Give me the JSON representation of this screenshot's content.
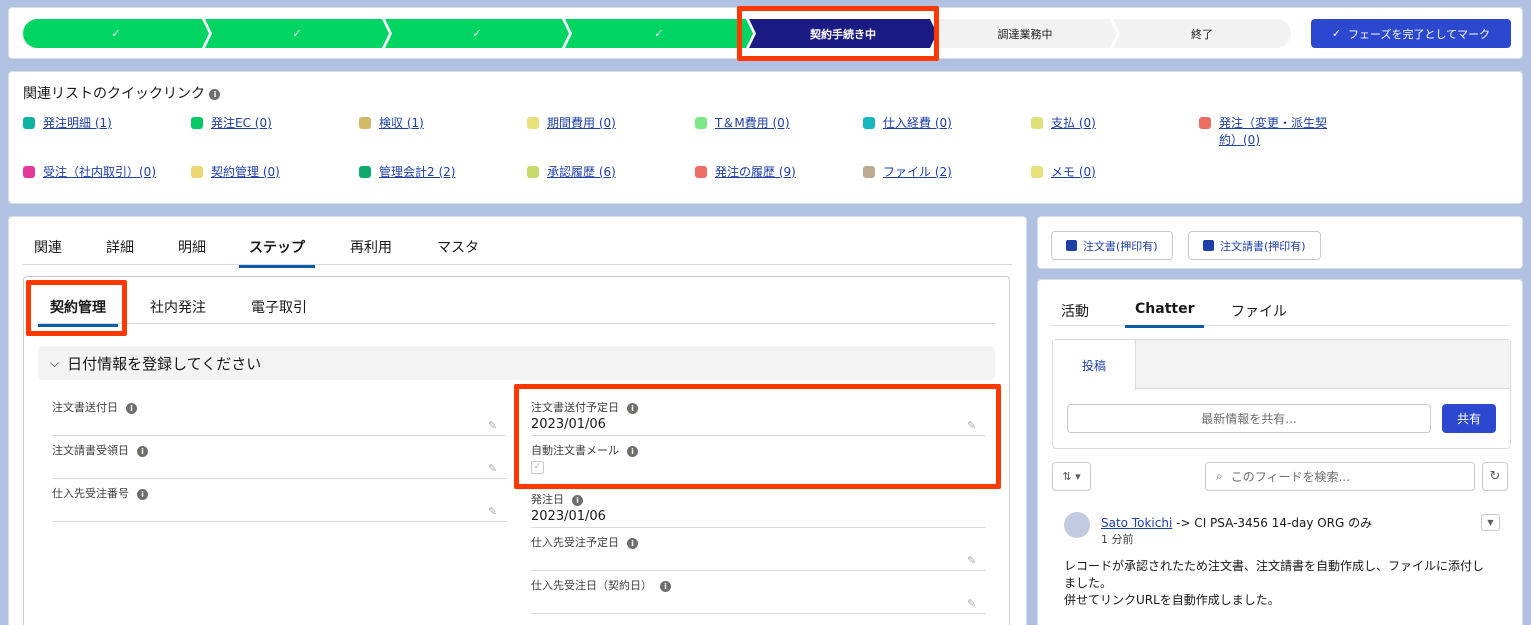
{
  "path": {
    "steps": [
      {
        "label": "✓",
        "state": "done"
      },
      {
        "label": "✓",
        "state": "done"
      },
      {
        "label": "✓",
        "state": "done"
      },
      {
        "label": "✓",
        "state": "done"
      },
      {
        "label": "契約手続き中",
        "state": "current"
      },
      {
        "label": "調達業務中",
        "state": "todo"
      },
      {
        "label": "終了",
        "state": "todo"
      }
    ],
    "mark_button": "フェーズを完了としてマーク"
  },
  "quicklinks": {
    "title": "関連リストのクイックリンク",
    "items": [
      {
        "label": "発注明細 (1)",
        "color": "#0fb3a3"
      },
      {
        "label": "発注EC (0)",
        "color": "#04c866"
      },
      {
        "label": "検収 (1)",
        "color": "#d5b96a"
      },
      {
        "label": "期間費用 (0)",
        "color": "#e8e07a"
      },
      {
        "label": "T＆M費用 (0)",
        "color": "#7de88a"
      },
      {
        "label": "仕入経費 (0)",
        "color": "#16b6c1"
      },
      {
        "label": "支払 (0)",
        "color": "#e0e07a"
      },
      {
        "label": "発注（変更・派生契約）(0)",
        "color": "#ef6e64"
      },
      {
        "label": "受注（社内取引）(0)",
        "color": "#e6379a"
      },
      {
        "label": "契約管理 (0)",
        "color": "#ecd873"
      },
      {
        "label": "管理会計2 (2)",
        "color": "#11a86b"
      },
      {
        "label": "承認履歴 (6)",
        "color": "#c9d86a"
      },
      {
        "label": "発注の履歴 (9)",
        "color": "#ef6e64"
      },
      {
        "label": "ファイル (2)",
        "color": "#bcab90"
      },
      {
        "label": "メモ (0)",
        "color": "#e8e07a"
      }
    ]
  },
  "main": {
    "tabs": [
      "関連",
      "詳細",
      "明細",
      "ステップ",
      "再利用",
      "マスタ"
    ],
    "active_tab": "ステップ",
    "subtabs": [
      "契約管理",
      "社内発注",
      "電子取引"
    ],
    "section_title": "日付情報を登録してください",
    "left_fields": [
      {
        "label": "注文書送付日",
        "value": ""
      },
      {
        "label": "注文請書受領日",
        "value": ""
      },
      {
        "label": "仕入先受注番号",
        "value": ""
      }
    ],
    "right_fields": [
      {
        "label": "注文書送付予定日",
        "value": "2023/01/06"
      },
      {
        "label": "自動注文書メール",
        "value": "",
        "checkbox": true
      },
      {
        "label": "発注日",
        "value": "2023/01/06"
      },
      {
        "label": "仕入先受注予定日",
        "value": ""
      },
      {
        "label": "仕入先受注日（契約日）",
        "value": ""
      }
    ]
  },
  "docs": {
    "buttons": [
      "注文書(押印有)",
      "注文請書(押印有)"
    ]
  },
  "chatter": {
    "tabs": [
      "活動",
      "Chatter",
      "ファイル"
    ],
    "publisher_tab": "投稿",
    "share_placeholder": "最新情報を共有...",
    "share_button": "共有",
    "search_placeholder": "このフィードを検索...",
    "post": {
      "user": "Sato Tokichi",
      "target": " -> CI PSA-3456 14-day ORG のみ",
      "time": "1 分前",
      "body_1": "レコードが承認されたため注文書、注文請書を自動作成し、ファイルに添付しました。",
      "body_2": "併せてリンクURLを自動作成しました。"
    }
  }
}
